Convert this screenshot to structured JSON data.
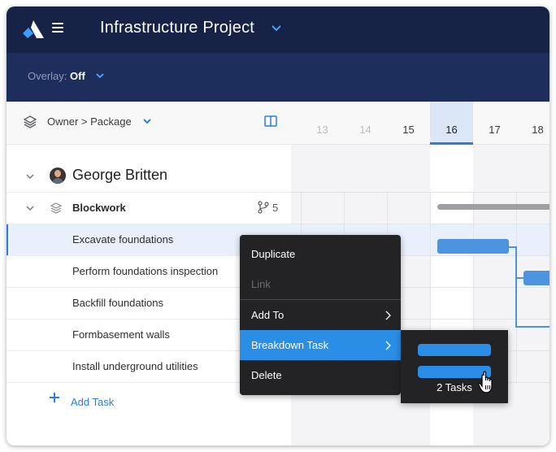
{
  "header": {
    "project_title": "Infrastructure Project",
    "icons": [
      "app-logo",
      "hamburger-menu-icon",
      "chevron-down-icon"
    ]
  },
  "subbar": {
    "overlay_label": "Overlay:",
    "overlay_value": "Off"
  },
  "left_panel": {
    "grouping_label": "Owner > Package",
    "owner": {
      "name": "George Britten"
    },
    "package": {
      "name": "Blockwork",
      "branch_count": "5"
    },
    "tasks": [
      {
        "label": "Excavate foundations",
        "selected": true
      },
      {
        "label": "Perform foundations inspection",
        "selected": false
      },
      {
        "label": "Backfill foundations",
        "selected": false
      },
      {
        "label": "Formbasement walls",
        "selected": false
      },
      {
        "label": "Install underground utilities",
        "selected": false
      }
    ],
    "add_task_label": "Add Task"
  },
  "timeline": {
    "days": [
      "13",
      "14",
      "15",
      "16",
      "17",
      "18"
    ],
    "today": "16"
  },
  "context_menu": {
    "items": [
      {
        "label": "Duplicate",
        "state": "normal"
      },
      {
        "label": "Link",
        "state": "disabled"
      },
      {
        "label": "Add To",
        "state": "normal",
        "submenu": true
      },
      {
        "label": "Breakdown Task",
        "state": "active",
        "submenu": true
      },
      {
        "label": "Delete",
        "state": "normal"
      }
    ]
  },
  "submenu": {
    "count_label": "2 Tasks"
  },
  "colors": {
    "topbar": "#172346",
    "subbar": "#1d2d5c",
    "accent": "#2b7de0",
    "menu_bg": "#232325",
    "task_bar": "#4d94df"
  }
}
